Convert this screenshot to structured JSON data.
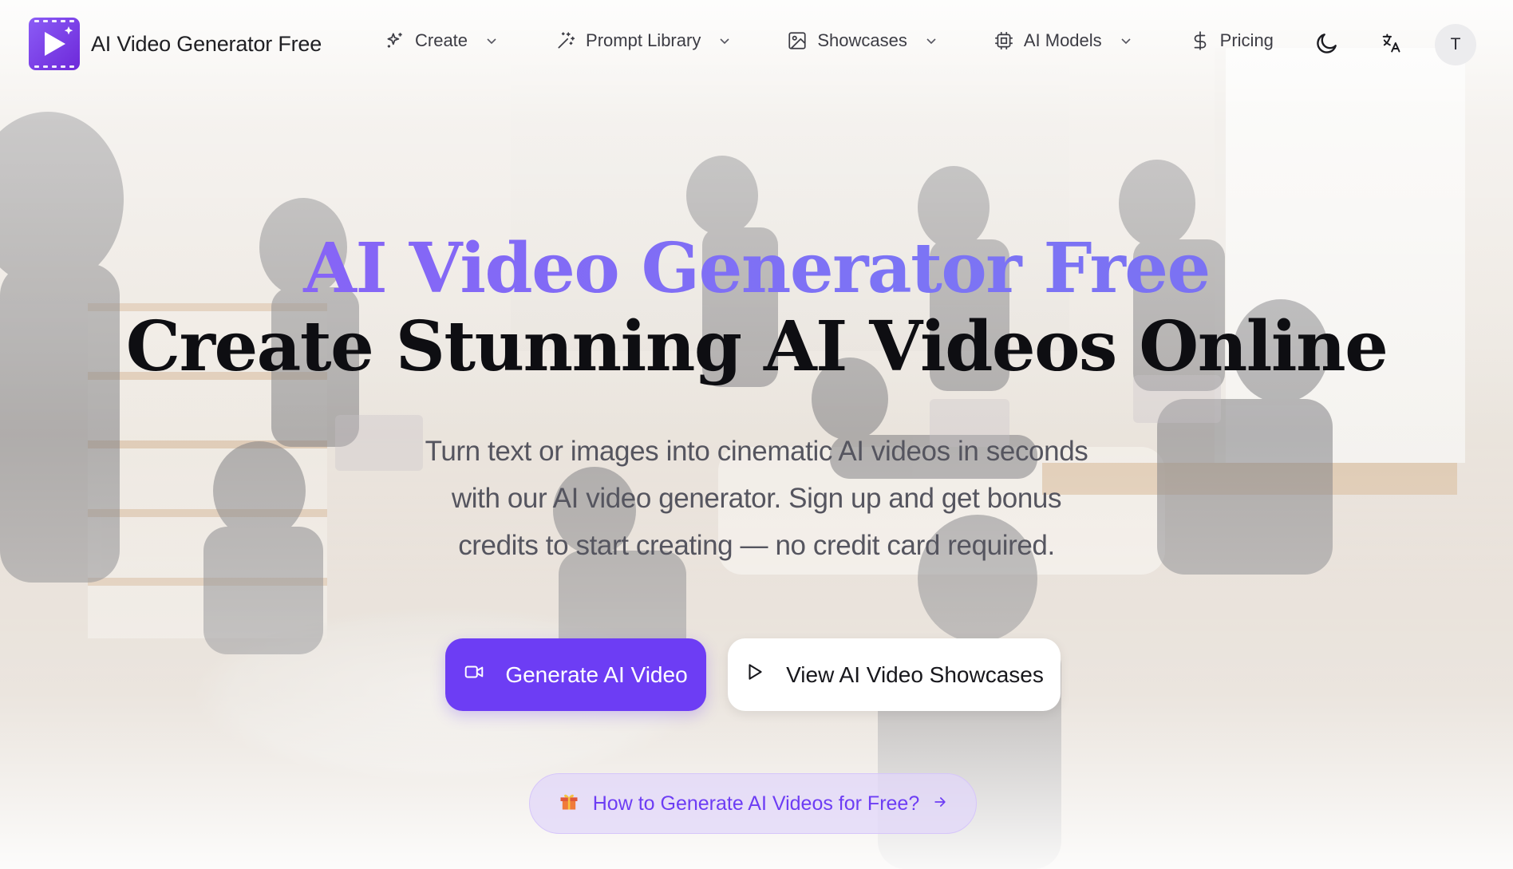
{
  "brand": {
    "name": "AI Video Generator Free",
    "logo_icon": "play-film-icon"
  },
  "nav": {
    "items": [
      {
        "label": "Create",
        "icon": "sparkles-icon",
        "has_dropdown": true
      },
      {
        "label": "Prompt Library",
        "icon": "magic-wand-icon",
        "has_dropdown": true
      },
      {
        "label": "Showcases",
        "icon": "image-icon",
        "has_dropdown": true
      },
      {
        "label": "AI Models",
        "icon": "chip-icon",
        "has_dropdown": true
      },
      {
        "label": "Pricing",
        "icon": "dollar-icon",
        "has_dropdown": false
      }
    ],
    "theme_toggle_icon": "moon-icon",
    "language_icon": "translate-icon",
    "avatar_initial": "T"
  },
  "hero": {
    "title_line1": "AI Video Generator Free",
    "title_line2": "Create Stunning AI Videos Online",
    "subtitle_lines": [
      "Turn text or images into cinematic AI videos in seconds",
      "with our AI video generator. Sign up and get bonus",
      "credits to start creating — no credit card required."
    ],
    "primary_button": {
      "label": "Generate AI Video",
      "icon": "video-camera-icon"
    },
    "secondary_button": {
      "label": "View AI Video Showcases",
      "icon": "play-icon"
    },
    "promo_pill": {
      "label": "How to Generate AI Videos for Free?",
      "icon": "gift-icon",
      "trailing_icon": "arrow-right-icon"
    }
  },
  "colors": {
    "accent": "#6d3df4",
    "title_gradient_start": "#8b5cf6",
    "title_gradient_end": "#7a6ff0",
    "text_dark": "#0e0e12",
    "text_muted": "#55555f"
  }
}
